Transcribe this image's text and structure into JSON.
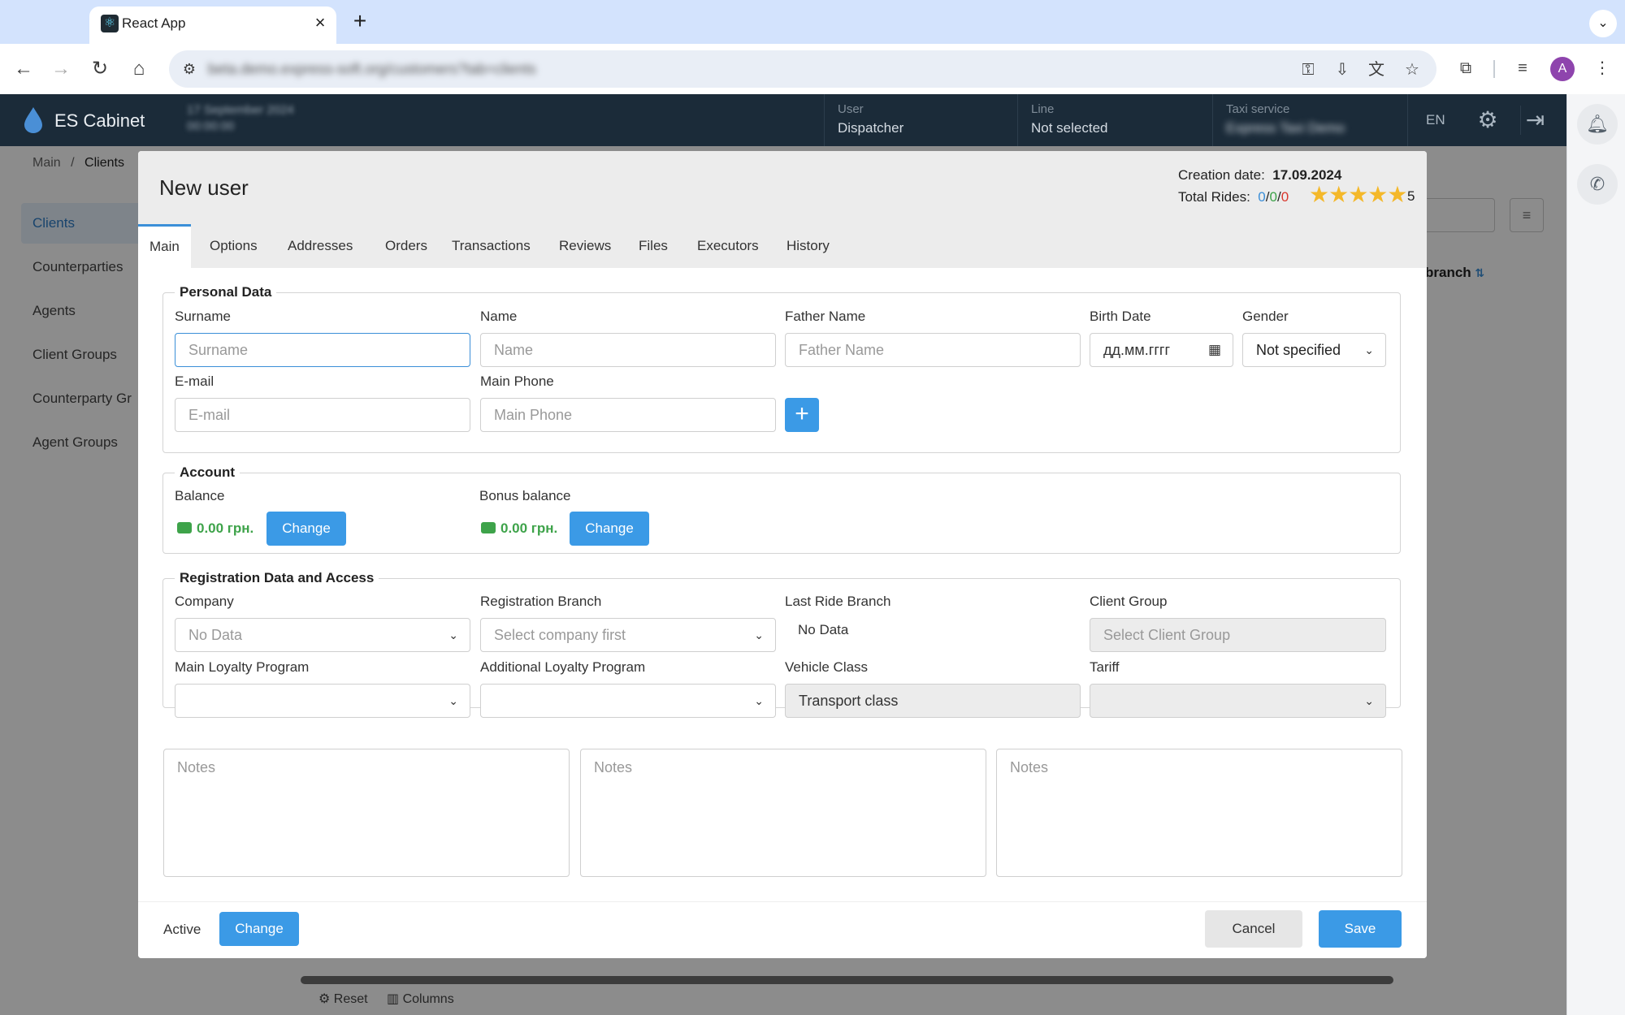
{
  "browser": {
    "tab_title": "React App",
    "tab_favicon": "react-icon",
    "url": "beta.demo.express-soft.org/customers?tab=clients",
    "icons": [
      "key-icon",
      "install-icon",
      "translate-icon",
      "bookmark-star-icon",
      "extensions-icon",
      "media-icon"
    ],
    "profile_initial": "A"
  },
  "app": {
    "title": "ES Cabinet",
    "date_blurred": "17 September 2024",
    "time_blurred": "00:00:00",
    "user_caption": "User",
    "user_value": "Dispatcher",
    "line_caption": "Line",
    "line_value": "Not selected",
    "taxi_caption": "Taxi service",
    "taxi_value": "Express Taxi Demo",
    "lang": "EN"
  },
  "page": {
    "breadcrumb_main": "Main",
    "breadcrumb_sep": "/",
    "breadcrumb_current": "Clients",
    "sidebar": [
      {
        "label": "Clients",
        "active": true
      },
      {
        "label": "Counterparties"
      },
      {
        "label": "Agents"
      },
      {
        "label": "Client Groups"
      },
      {
        "label": "Counterparty Gr"
      },
      {
        "label": "Agent Groups"
      }
    ],
    "table_header_branch": "branch",
    "footer_reset": "Reset",
    "footer_columns": "Columns"
  },
  "modal": {
    "title": "New user",
    "creation_label": "Creation date:",
    "creation_value": "17.09.2024",
    "rides_label": "Total Rides:",
    "rides_blue": "0",
    "rides_green": "0",
    "rides_red": "0",
    "rides_sep": "/",
    "stars": "★★★★★",
    "rating": "5",
    "tabs": [
      "Main",
      "Options",
      "Addresses",
      "Orders",
      "Transactions",
      "Reviews",
      "Files",
      "Executors",
      "History"
    ],
    "personal": {
      "title": "Personal Data",
      "surname_label": "Surname",
      "surname_placeholder": "Surname",
      "name_label": "Name",
      "name_placeholder": "Name",
      "father_label": "Father Name",
      "father_placeholder": "Father Name",
      "birth_label": "Birth Date",
      "birth_placeholder": "дд.мм.гггг",
      "gender_label": "Gender",
      "gender_value": "Not specified",
      "email_label": "E-mail",
      "email_placeholder": "E-mail",
      "phone_label": "Main Phone",
      "phone_placeholder": "Main Phone",
      "add_phone": "+"
    },
    "account": {
      "title": "Account",
      "balance_label": "Balance",
      "balance_value": "0.00 грн.",
      "bonus_label": "Bonus balance",
      "bonus_value": "0.00 грн.",
      "change": "Change"
    },
    "registration": {
      "title": "Registration Data and Access",
      "company_label": "Company",
      "company_value": "No Data",
      "branch_label": "Registration Branch",
      "branch_value": "Select company first",
      "last_ride_label": "Last Ride Branch",
      "last_ride_value": "No Data",
      "client_group_label": "Client Group",
      "client_group_value": "Select Client Group",
      "main_loyalty_label": "Main Loyalty Program",
      "add_loyalty_label": "Additional Loyalty Program",
      "vehicle_label": "Vehicle Class",
      "vehicle_value": "Transport class",
      "tariff_label": "Tariff"
    },
    "notes_placeholder": "Notes",
    "footer": {
      "active_label": "Active",
      "change": "Change",
      "cancel": "Cancel",
      "save": "Save"
    }
  },
  "colors": {
    "accent": "#3b9ae6",
    "header_bg": "#1b2b39",
    "money": "#3ea34a",
    "star": "#f4b82a",
    "rides_blue": "#3b8fd8",
    "rides_green": "#3ea34a",
    "rides_red": "#d9382e"
  }
}
